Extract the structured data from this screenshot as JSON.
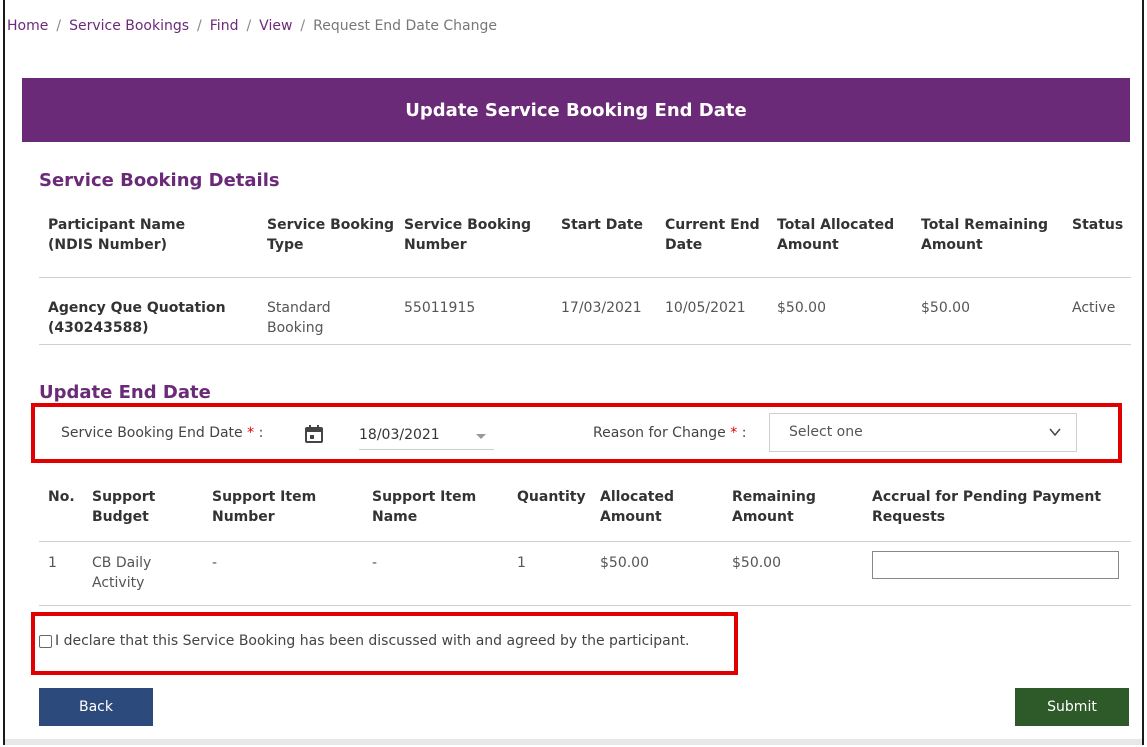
{
  "breadcrumb": {
    "home": "Home",
    "service_bookings": "Service Bookings",
    "find": "Find",
    "view": "View",
    "current": "Request End Date Change",
    "separator": "/"
  },
  "banner": {
    "title": "Update Service Booking End Date"
  },
  "details": {
    "title": "Service Booking Details",
    "headers": {
      "participant_1": "Participant Name",
      "participant_2": "(NDIS Number)",
      "type_1": "Service Booking",
      "type_2": "Type",
      "number_1": "Service Booking",
      "number_2": "Number",
      "start": "Start Date",
      "end_1": "Current End",
      "end_2": "Date",
      "allocated_1": "Total Allocated",
      "allocated_2": "Amount",
      "remaining_1": "Total Remaining",
      "remaining_2": "Amount",
      "status": "Status"
    },
    "row": {
      "participant_1": "Agency Que Quotation",
      "participant_2": "(430243588)",
      "type_1": "Standard",
      "type_2": "Booking",
      "number": "55011915",
      "start": "17/03/2021",
      "end": "10/05/2021",
      "allocated": "$50.00",
      "remaining": "$50.00",
      "status": "Active"
    }
  },
  "update": {
    "title": "Update End Date",
    "end_date_label": "Service Booking End Date",
    "end_date_value": "18/03/2021",
    "reason_label": "Reason for Change",
    "reason_value": "Select one",
    "required_mark": "*",
    "colon": ":"
  },
  "items": {
    "headers": {
      "no": "No.",
      "budget_1": "Support",
      "budget_2": "Budget",
      "item_number_1": "Support Item",
      "item_number_2": "Number",
      "item_name_1": "Support Item",
      "item_name_2": "Name",
      "quantity": "Quantity",
      "allocated_1": "Allocated",
      "allocated_2": "Amount",
      "remaining_1": "Remaining",
      "remaining_2": "Amount",
      "accrual_1": "Accrual for Pending Payment",
      "accrual_2": "Requests"
    },
    "row": {
      "no": "1",
      "budget_1": "CB Daily",
      "budget_2": "Activity",
      "item_number": "-",
      "item_name": "-",
      "quantity": "1",
      "allocated": "$50.00",
      "remaining": "$50.00",
      "accrual": ""
    }
  },
  "declaration": {
    "text": "I declare that this Service Booking has been discussed with and agreed by the participant."
  },
  "buttons": {
    "back": "Back",
    "submit": "Submit"
  },
  "colors": {
    "brand_purple": "#6b2a77",
    "back_blue": "#2d4a7d",
    "submit_green": "#2e5a2a",
    "highlight_red": "#e00000"
  }
}
